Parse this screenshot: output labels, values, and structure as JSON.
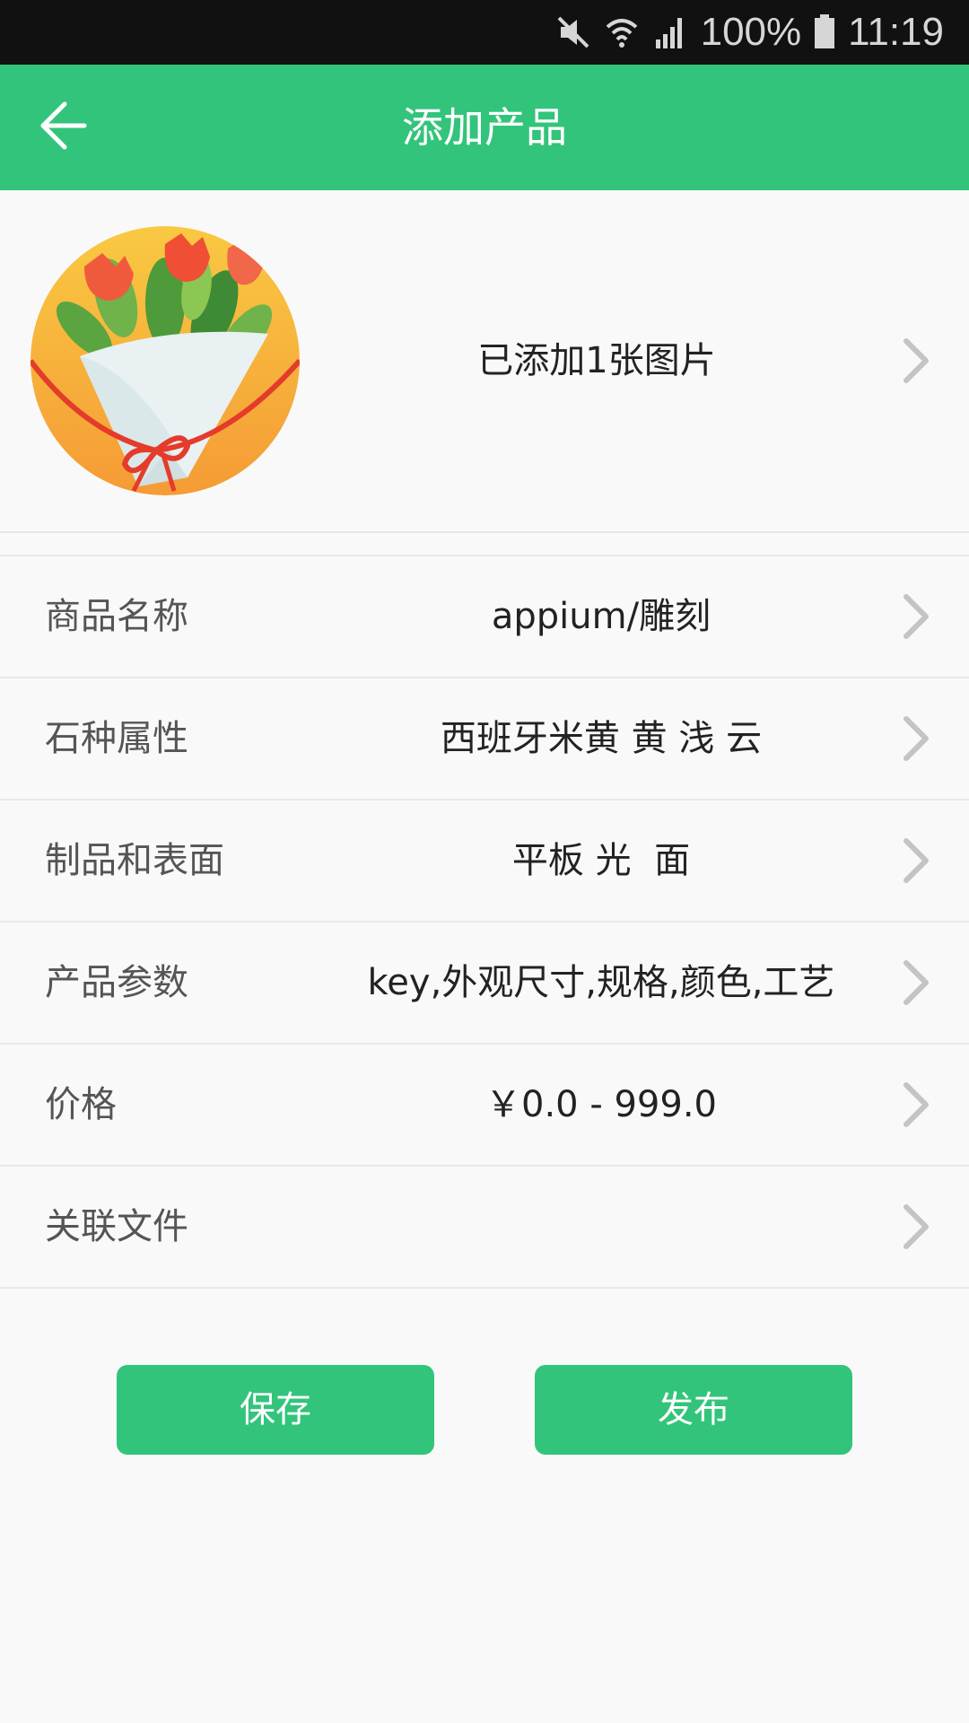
{
  "status_bar": {
    "battery": "100%",
    "time": "11:19",
    "icons": [
      "mute-icon",
      "wifi-icon",
      "signal-icon",
      "battery-icon"
    ]
  },
  "header": {
    "title": "添加产品",
    "back_icon": "arrow-left-icon"
  },
  "image_section": {
    "thumbnail": "flower-bouquet-image",
    "count_text": "已添加1张图片"
  },
  "rows": [
    {
      "label": "商品名称",
      "value": "appium/雕刻"
    },
    {
      "label": "石种属性",
      "value": "西班牙米黄 黄 浅 云"
    },
    {
      "label": "制品和表面",
      "value": "平板 光  面"
    },
    {
      "label": "产品参数",
      "value": "key,外观尺寸,规格,颜色,工艺"
    },
    {
      "label": "价格",
      "value": "￥0.0 - 999.0"
    },
    {
      "label": "关联文件",
      "value": ""
    }
  ],
  "buttons": {
    "save": "保存",
    "publish": "发布"
  },
  "colors": {
    "accent": "#33c47b",
    "status_bar": "#111111",
    "background": "#f9f9f9"
  }
}
